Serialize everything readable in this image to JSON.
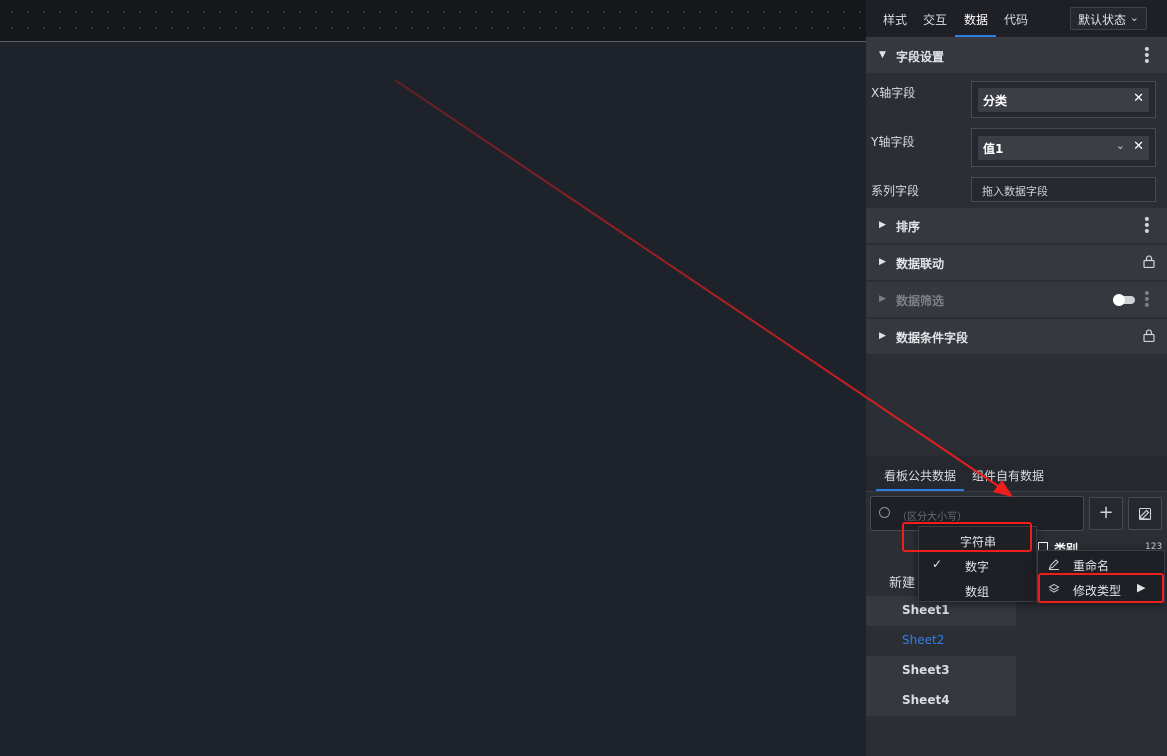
{
  "panel": {
    "tabs": [
      "样式",
      "交互",
      "数据",
      "代码"
    ],
    "state_select": "默认状态",
    "field_settings": {
      "title": "字段设置",
      "x_label": "X轴字段",
      "x_value": "分类",
      "y_label": "Y轴字段",
      "y_value": "值1",
      "series_label": "系列字段",
      "series_placeholder": "拖入数据字段"
    },
    "sections": {
      "sort": "排序",
      "linkage": "数据联动",
      "filter": "数据筛选",
      "condition": "数据条件字段"
    },
    "data_tabs": [
      "看板公共数据",
      "组件自有数据"
    ],
    "search_placeholder": "（区分大小写）",
    "new_label": "新建",
    "sheets": [
      "Sheet1",
      "Sheet2",
      "Sheet3",
      "Sheet4"
    ],
    "column_header": "类别",
    "column_type_badge": "123"
  },
  "type_menu": {
    "items": [
      "字符串",
      "数字",
      "数组"
    ],
    "checked": "数字"
  },
  "column_menu": {
    "rename": "重命名",
    "change_type": "修改类型"
  },
  "colors": {
    "accent": "#2f7ee8",
    "annotation": "#f01d1d"
  }
}
